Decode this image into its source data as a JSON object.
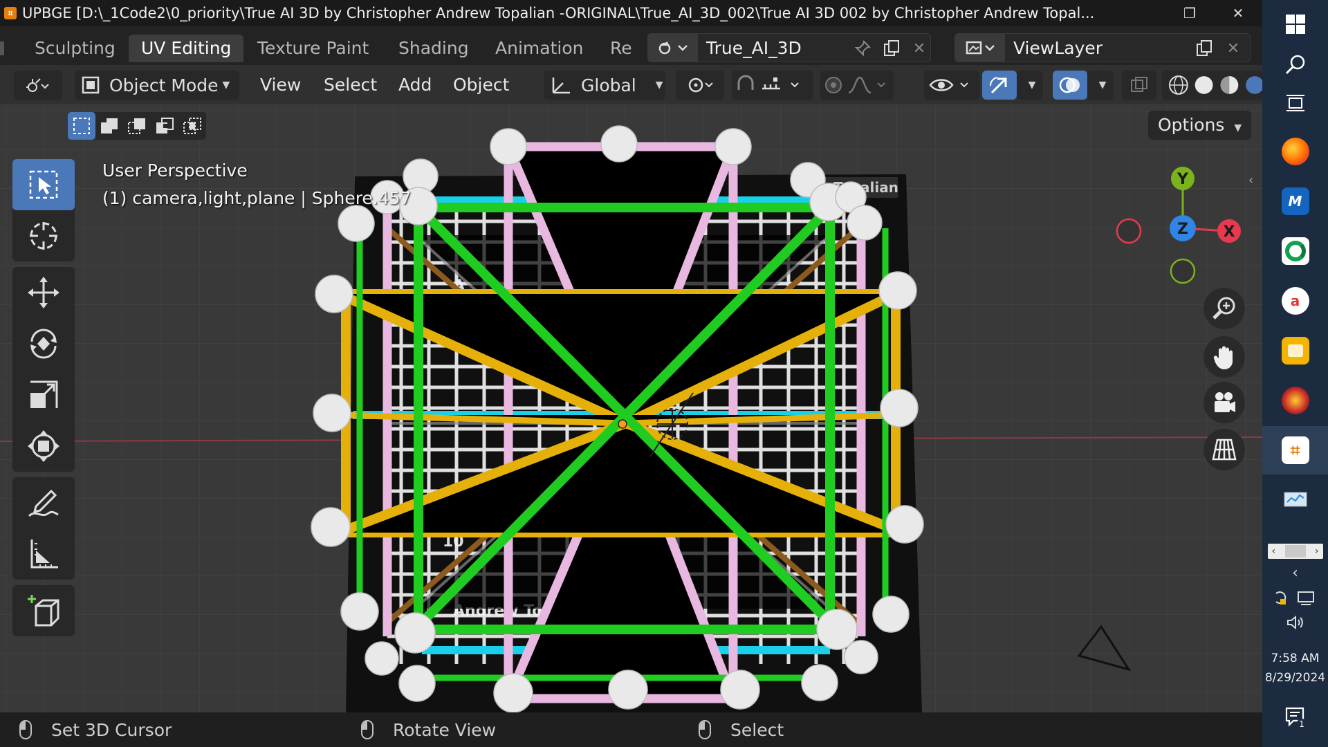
{
  "window": {
    "title": "UPBGE [D:\\_1Code2\\0_priority\\True AI 3D by Christopher Andrew Topalian -ORIGINAL\\True_AI_3D_002\\True AI 3D 002 by Christopher Andrew Topal...",
    "logo_icon": "upbge-logo-icon",
    "restore_icon": "restore-window-icon",
    "close_icon": "close-window-icon"
  },
  "workspaces": {
    "tabs": [
      {
        "label": "Sculpting",
        "active": false
      },
      {
        "label": "UV Editing",
        "active": true
      },
      {
        "label": "Texture Paint",
        "active": false
      },
      {
        "label": "Shading",
        "active": false
      },
      {
        "label": "Animation",
        "active": false
      },
      {
        "label": "Re",
        "active": false
      }
    ],
    "scene_name": "True_AI_3D",
    "view_layer": "ViewLayer"
  },
  "header": {
    "mode": "Object Mode",
    "menus": [
      "View",
      "Select",
      "Add",
      "Object"
    ],
    "orientation": "Global"
  },
  "viewport": {
    "options_label": "Options",
    "perspective_label": "User Perspective",
    "object_info": "(1) camera,light,plane | Sphere.457",
    "gizmo": {
      "y": "Y",
      "z": "Z",
      "x": "X",
      "x_color": "#e83a4f",
      "y_color": "#7bb31b",
      "z_color": "#2f86e6"
    },
    "scene_text": {
      "top_right": "Topalian",
      "left_fragment": "A",
      "bottom_fragment": "Andrew Topal",
      "number_fragment": "10"
    }
  },
  "statusbar": {
    "items": [
      "Set 3D Cursor",
      "Rotate View",
      "Select"
    ]
  },
  "taskbar": {
    "time": "7:58 AM",
    "date": "8/29/2024",
    "notification_count": "1",
    "apps": [
      "windows-start-icon",
      "search-icon",
      "task-view-icon",
      "firefox-icon",
      "mathematica-icon",
      "edge-icon",
      "app-a-icon",
      "files-icon",
      "game-icon",
      "upbge-icon",
      "network-monitor-icon"
    ]
  },
  "colors": {
    "accent_blue": "#4a78b8",
    "green_struts": "#1fcc1f",
    "yellow_struts": "#e6b00a",
    "pink_struts": "#e8b8e0",
    "cyan_struts": "#1ad0e8"
  }
}
